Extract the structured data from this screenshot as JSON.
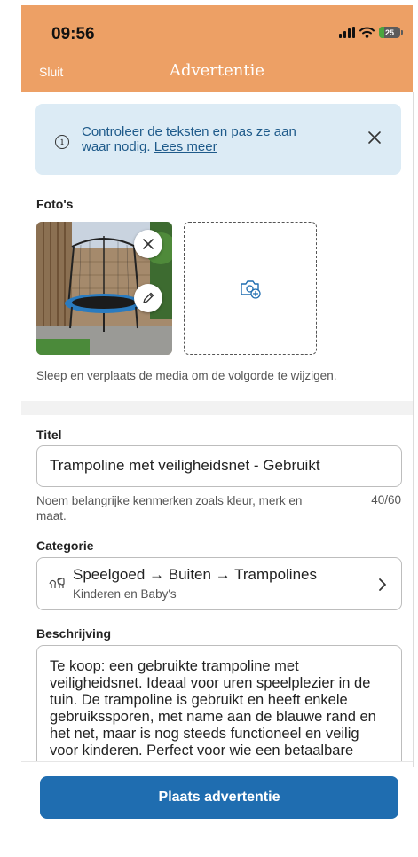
{
  "status_bar": {
    "time": "09:56",
    "battery": "25",
    "battery_level": 0.25
  },
  "nav": {
    "close_label": "Sluit",
    "title": "Advertentie"
  },
  "info_banner": {
    "text": "Controleer de teksten en pas ze aan waar nodig.",
    "link": "Lees meer"
  },
  "photos": {
    "label": "Foto's",
    "hint": "Sleep en verplaats de media om de volgorde te wijzigen.",
    "items": [
      {
        "subject": "trampoline"
      }
    ]
  },
  "title_field": {
    "label": "Titel",
    "value": "Trampoline met veiligheidsnet - Gebruikt",
    "hint": "Noem belangrijke kenmerken zoals kleur, merk en maat.",
    "counter": "40/60"
  },
  "category": {
    "label": "Categorie",
    "path": "Speelgoed → Buiten → Trampolines",
    "parent": "Kinderen en Baby's"
  },
  "description": {
    "label": "Beschrijving",
    "value": "Te koop: een gebruikte trampoline met veiligheidsnet. Ideaal voor uren speelplezier in de tuin. De trampoline is gebruikt en heeft enkele gebruikssporen, met name aan de blauwe rand en het net, maar is nog steeds functioneel en veilig voor kinderen. Perfect voor wie een betaalbare"
  },
  "submit": {
    "label": "Plaats advertentie"
  },
  "colors": {
    "header": "#eda065",
    "accent": "#1f6db0",
    "info_bg": "#dcebf5",
    "info_text": "#1e5a8a"
  }
}
